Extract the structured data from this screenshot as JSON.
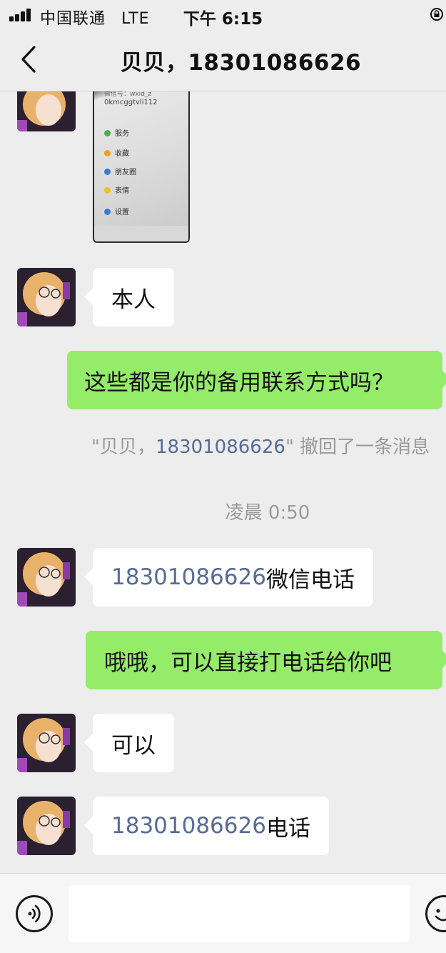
{
  "status_bar": {
    "carrier": "中国联通",
    "network": "LTE",
    "time": "下午 6:15"
  },
  "nav": {
    "title": "贝贝，18301086626"
  },
  "thumbnail": {
    "id_text_line1": "微信号：wxid_z",
    "id_text_line2": "0kmcggtvli112",
    "rows": [
      "服务",
      "收藏",
      "朋友圈",
      "表情",
      "设置"
    ]
  },
  "messages": {
    "m1": {
      "text": "本人"
    },
    "m2": {
      "text": "这些都是你的备用联系方式吗？"
    },
    "recall": {
      "quote_open": "\"贝贝，",
      "name_link": "18301086626",
      "quote_close": "\"",
      "suffix": " 撤回了一条消息"
    },
    "timestamp": "凌晨 0:50",
    "m3": {
      "link": "18301086626",
      "text": "微信电话"
    },
    "m4": {
      "text": "哦哦，可以直接打电话给你吧"
    },
    "m5": {
      "text": "可以"
    },
    "m6": {
      "link": "18301086626",
      "text": "电话"
    }
  },
  "input": {
    "value": "",
    "placeholder": ""
  },
  "colors": {
    "background": "#ededed",
    "outgoing_bubble": "#95ec69",
    "incoming_bubble": "#ffffff",
    "link": "#576b95",
    "system_text": "#9a9a9a"
  },
  "icons": {
    "back": "chevron-left-icon",
    "voice": "voice-icon",
    "emoji": "emoji-icon",
    "lock": "lock-rotation-icon"
  }
}
